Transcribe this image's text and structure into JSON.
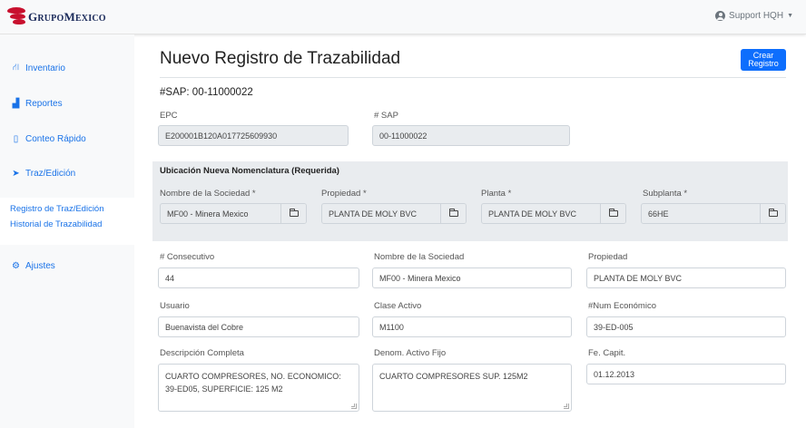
{
  "header": {
    "logo_text_big_1": "G",
    "logo_text_small_1": "RUPO",
    "logo_text_big_2": "M",
    "logo_text_small_2": "EXICO",
    "user_label": "Support HQH",
    "user_icon": "user-circle-icon"
  },
  "sidebar": {
    "items": [
      {
        "label": "Inventario",
        "icon": "sitemap-icon",
        "glyph": "⛙"
      },
      {
        "label": "Reportes",
        "icon": "chart-area-icon",
        "glyph": "▟"
      },
      {
        "label": "Conteo Rápido",
        "icon": "tablet-icon",
        "glyph": "▯"
      },
      {
        "label": "Traz/Edición",
        "icon": "paper-plane-icon",
        "glyph": "➤"
      },
      {
        "label": "Ajustes",
        "icon": "cogs-icon",
        "glyph": "⚙"
      }
    ],
    "submenu": [
      "Registro de Traz/Edición",
      "Historial de Trazabilidad"
    ]
  },
  "main": {
    "title": "Nuevo Registro de Trazabilidad",
    "create_button": "Crear Registro",
    "sap_heading": "#SAP: 00-11000022",
    "epc_label": "EPC",
    "epc_value": "E200001B120A017725609930",
    "sap_label": "# SAP",
    "sap_value": "00-11000022",
    "location": {
      "title": "Ubicación Nueva Nomenclatura (Requerida)",
      "sociedad_label": "Nombre de la Sociedad *",
      "sociedad_value": "MF00 - Minera Mexico",
      "propiedad_label": "Propiedad *",
      "propiedad_value": "PLANTA DE MOLY BVC",
      "planta_label": "Planta *",
      "planta_value": "PLANTA DE MOLY BVC",
      "subplanta_label": "Subplanta *",
      "subplanta_value": "66HE"
    },
    "fields": {
      "consecutivo_label": "# Consecutivo",
      "consecutivo_value": "44",
      "sociedad_label": "Nombre de la Sociedad",
      "sociedad_value": "MF00 - Minera Mexico",
      "propiedad_label": "Propiedad",
      "propiedad_value": "PLANTA DE MOLY BVC",
      "usuario_label": "Usuario",
      "usuario_value": "Buenavista del Cobre",
      "clase_label": "Clase Activo",
      "clase_value": "M1100",
      "num_label": "#Num Económico",
      "num_value": "39-ED-005",
      "descripcion_label": "Descripción Completa",
      "descripcion_value": "CUARTO COMPRESORES, NO. ECONOMICO: 39-ED05, SUPERFICIE: 125 M2",
      "denom_label": "Denom. Activo Fijo",
      "denom_value": "CUARTO COMPRESORES SUP. 125M2",
      "fecha_label": "Fe. Capit.",
      "fecha_value": "01.12.2013"
    }
  }
}
